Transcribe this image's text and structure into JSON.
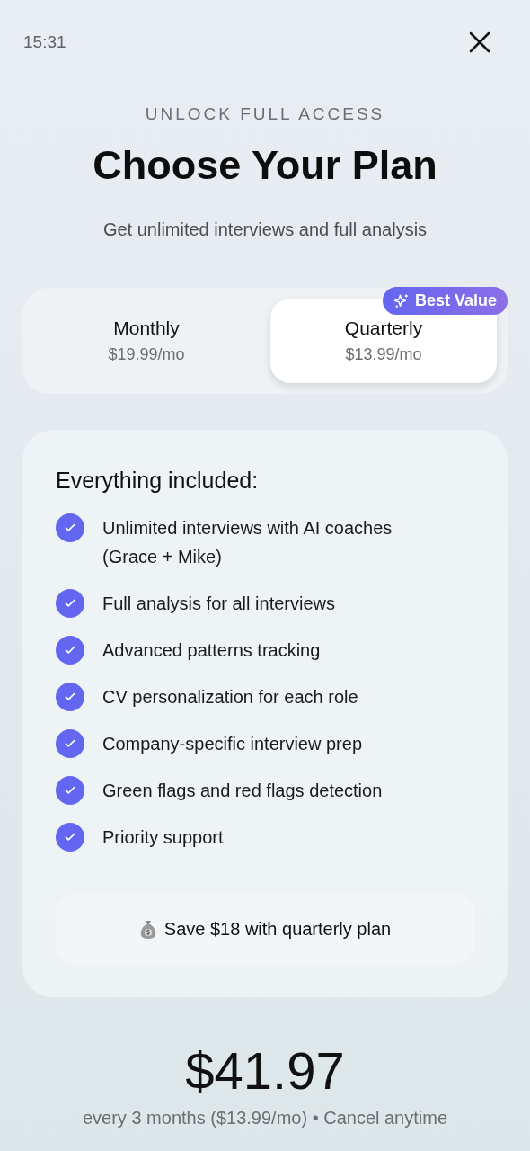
{
  "status_bar": {
    "time": "15:31"
  },
  "header": {
    "eyebrow": "UNLOCK FULL ACCESS",
    "title": "Choose Your Plan",
    "subtitle": "Get unlimited interviews and full analysis"
  },
  "plans": [
    {
      "name": "Monthly",
      "price": "$19.99/mo",
      "selected": false
    },
    {
      "name": "Quarterly",
      "price": "$13.99/mo",
      "selected": true,
      "badge": "Best Value"
    }
  ],
  "features": {
    "heading": "Everything included:",
    "items": [
      {
        "text": "Unlimited interviews with AI coaches (Grace + Mike)",
        "checked": true
      },
      {
        "text": "Full analysis for all interviews",
        "checked": true
      },
      {
        "text": "Advanced patterns tracking",
        "checked": true
      },
      {
        "text": "CV personalization for each role",
        "checked": true
      },
      {
        "text": "Company-specific interview prep",
        "checked": true
      },
      {
        "text": "Green flags and red flags detection",
        "checked": true
      },
      {
        "text": "Priority support",
        "checked": true
      }
    ],
    "savings": "Save $18 with quarterly plan"
  },
  "price": {
    "total": "$41.97",
    "note": "every 3 months ($13.99/mo) • Cancel anytime"
  }
}
